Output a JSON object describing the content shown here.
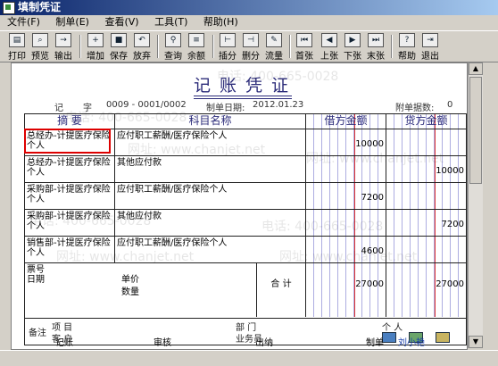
{
  "window": {
    "title": "填制凭证"
  },
  "menu": [
    "文件(F)",
    "制单(E)",
    "查看(V)",
    "工具(T)",
    "帮助(H)"
  ],
  "toolbar": [
    {
      "label": "打印",
      "icon": "print-icon"
    },
    {
      "label": "预览",
      "icon": "preview-icon"
    },
    {
      "label": "输出",
      "icon": "export-icon"
    },
    {
      "label": "增加",
      "icon": "add-icon"
    },
    {
      "label": "保存",
      "icon": "save-icon"
    },
    {
      "label": "放弃",
      "icon": "undo-icon"
    },
    {
      "label": "查询",
      "icon": "search-icon"
    },
    {
      "label": "余额",
      "icon": "balance-icon"
    },
    {
      "label": "插分",
      "icon": "insert-row-icon"
    },
    {
      "label": "删分",
      "icon": "delete-row-icon"
    },
    {
      "label": "流量",
      "icon": "flow-icon"
    },
    {
      "label": "首张",
      "icon": "first-icon"
    },
    {
      "label": "上张",
      "icon": "prev-icon"
    },
    {
      "label": "下张",
      "icon": "next-icon"
    },
    {
      "label": "末张",
      "icon": "last-icon"
    },
    {
      "label": "帮助",
      "icon": "help-icon"
    },
    {
      "label": "退出",
      "icon": "exit-icon"
    }
  ],
  "voucher": {
    "title": "记账凭证",
    "type": "记",
    "zi": "字",
    "number": "0009 - 0001/0002",
    "date_label": "制单日期:",
    "date": "2012.01.23",
    "attach_label": "附单据数:",
    "attach_count": "0",
    "headers": {
      "summary": "摘 要",
      "account": "科目名称",
      "debit": "借方金额",
      "credit": "贷方金额"
    },
    "rows": [
      {
        "summary": "总经办-计提医疗保险个人",
        "account": "应付职工薪酬/医疗保险个人",
        "debit": "10000",
        "credit": ""
      },
      {
        "summary": "总经办-计提医疗保险个人",
        "account": "其他应付款",
        "debit": "",
        "credit": "10000"
      },
      {
        "summary": "采购部-计提医疗保险个人",
        "account": "应付职工薪酬/医疗保险个人",
        "debit": "7200",
        "credit": ""
      },
      {
        "summary": "采购部-计提医疗保险个人",
        "account": "其他应付款",
        "debit": "",
        "credit": "7200"
      },
      {
        "summary": "销售部-计提医疗保险个人",
        "account": "应付职工薪酬/医疗保险个人",
        "debit": "4600",
        "credit": ""
      }
    ],
    "footer": {
      "bill_no": "票号",
      "date": "日期",
      "unit_price": "单价",
      "quantity": "数量",
      "total_label": "合 计",
      "total_debit": "27000",
      "total_credit": "27000",
      "remark": "备注",
      "project": "项 目",
      "customer": "客 户",
      "department": "部 门",
      "individual": "个 人",
      "salesperson": "业务员"
    }
  },
  "signatures": {
    "bookkeeper": "记账",
    "auditor": "审核",
    "cashier": "出纳",
    "maker_label": "制单",
    "maker": "刘小艳"
  },
  "watermarks": [
    "电话: 400-665-0028",
    "网址: www.chanjet.net",
    "电话: 400-665-0028",
    "网址: www.chanjet.net",
    "电话: 400-665-0028",
    "网址: www.chanjet.net",
    "电话: 400-665-0028",
    "网址: www.chanjet.net"
  ]
}
